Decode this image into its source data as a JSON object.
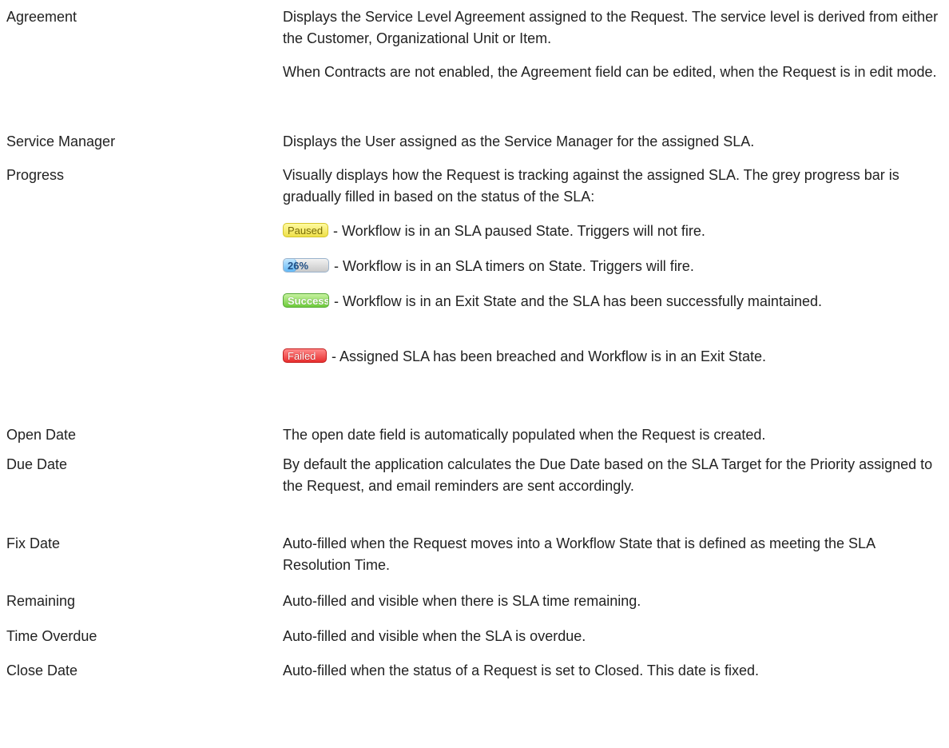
{
  "rows": [
    {
      "term": "Agreement",
      "paras": [
        "Displays the Service Level Agreement assigned to the Request. The service level is derived from either the Customer, Organizational Unit or Item.",
        "When Contracts are not enabled, the Agreement field can be edited, when the Request is in edit mode."
      ]
    },
    {
      "term": "Service Manager",
      "paras": [
        "Displays the User assigned as the Service Manager for the assigned SLA."
      ]
    },
    {
      "term": "Progress",
      "paras": [
        "Visually displays how the Request is tracking against the assigned SLA. The grey progress bar is gradually filled in based on the status of the SLA:"
      ],
      "badges": [
        {
          "label": "Paused",
          "desc": "- Workflow is in an SLA paused State. Triggers will not fire."
        },
        {
          "label": "26%",
          "progress_percent": 26,
          "desc": "- Workflow is in an SLA timers on State. Triggers will fire."
        },
        {
          "label": "Success",
          "desc": "- Workflow is in an Exit State and the SLA has been successfully maintained."
        },
        {
          "label": "Failed",
          "desc": "- Assigned SLA has been breached and Workflow is in an Exit State."
        }
      ]
    },
    {
      "term": "Open Date",
      "paras": [
        "The open date field is automatically populated when the Request is created."
      ]
    },
    {
      "term": "Due Date",
      "paras": [
        "By default the application calculates the Due Date based on the SLA Target for the Priority assigned to the Request, and email reminders are sent accordingly."
      ]
    },
    {
      "term": "Fix Date",
      "paras": [
        "Auto-filled when the Request moves into a Workflow State that is defined as meeting the SLA Resolution Time."
      ]
    },
    {
      "term": "Remaining",
      "paras": [
        "Auto-filled and visible when there is SLA time remaining."
      ]
    },
    {
      "term": "Time Overdue",
      "paras": [
        "Auto-filled and visible when the SLA is overdue."
      ]
    },
    {
      "term": "Close Date",
      "paras": [
        "Auto-filled when the status of a Request is set to Closed. This date is fixed."
      ]
    }
  ],
  "colors": {
    "paused": "#eee04a",
    "progress": "#62b7f5",
    "success": "#6fcc3c",
    "failed": "#e82f2f"
  }
}
